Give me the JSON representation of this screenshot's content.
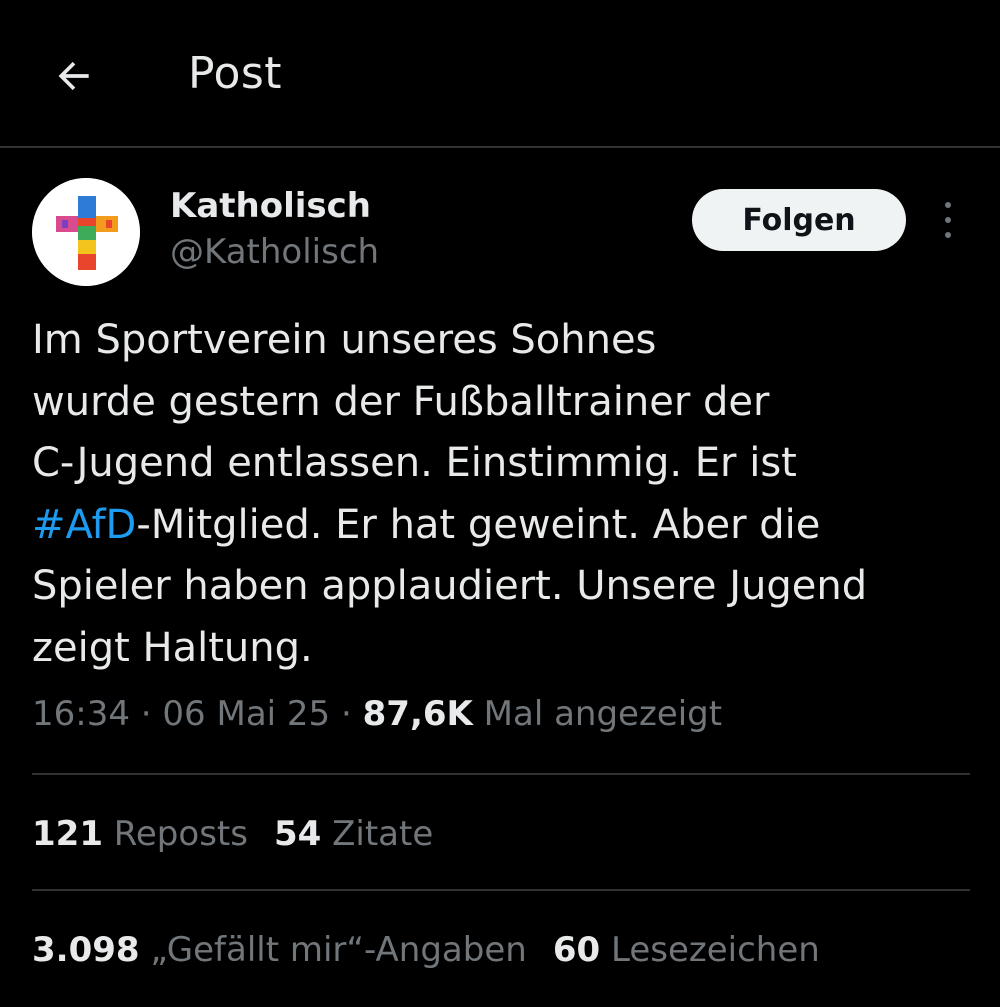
{
  "header": {
    "title": "Post",
    "back_icon": "arrow-left-icon"
  },
  "author": {
    "display_name": "Katholisch",
    "handle": "@Katholisch",
    "avatar_icon": "colorful-cross-icon"
  },
  "follow_button": {
    "label": "Folgen"
  },
  "more_icon": "more-vertical-icon",
  "tweet": {
    "line1": "Im Sportverein unseres Sohnes",
    "line2": "wurde gestern der Fußballtrainer der",
    "line3": "C-Jugend entlassen. Einstimmig. Er ist",
    "hashtag": "#AfD",
    "line4_rest": "-Mitglied. Er hat geweint. Aber die",
    "line5": "Spieler haben applaudiert. Unsere Jugend",
    "line6": "zeigt Haltung."
  },
  "meta": {
    "time": "16:34",
    "separator1": " · ",
    "date": "06 Mai 25",
    "separator2": " · ",
    "views_count": "87,6K",
    "views_label": " Mal angezeigt"
  },
  "stats": {
    "reposts_count": "121",
    "reposts_label": "Reposts",
    "quotes_count": "54",
    "quotes_label": "Zitate",
    "likes_count": "3.098",
    "likes_label": "„Gefällt mir“-Angaben",
    "bookmarks_count": "60",
    "bookmarks_label": "Lesezeichen"
  },
  "colors": {
    "background": "#000000",
    "text": "#e7e9ea",
    "secondary_text": "#71767b",
    "link": "#1d9bf0",
    "divider": "#2f3336",
    "button_bg": "#eff3f4"
  }
}
